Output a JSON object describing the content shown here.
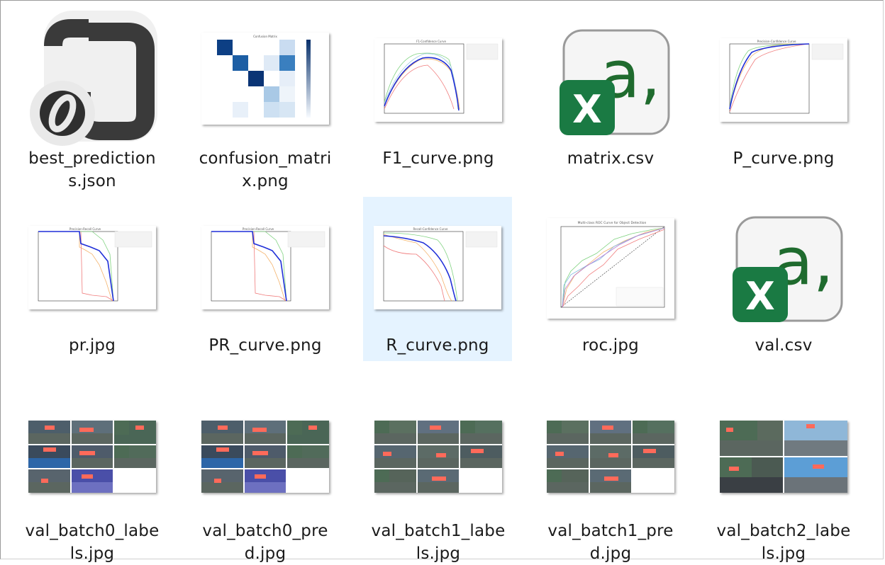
{
  "files": [
    {
      "name_lines": [
        "best_prediction",
        "s.json"
      ],
      "type": "json",
      "icon": "json-file-icon"
    },
    {
      "name_lines": [
        "confusion_matri",
        "x.png"
      ],
      "type": "confusion-matrix"
    },
    {
      "name_lines": [
        "F1_curve.png"
      ],
      "type": "curve"
    },
    {
      "name_lines": [
        "matrix.csv"
      ],
      "type": "csv",
      "icon": "excel-csv-icon"
    },
    {
      "name_lines": [
        "P_curve.png"
      ],
      "type": "curve"
    },
    {
      "name_lines": [
        "pr.jpg"
      ],
      "type": "curve"
    },
    {
      "name_lines": [
        "PR_curve.png"
      ],
      "type": "curve"
    },
    {
      "name_lines": [
        "R_curve.png"
      ],
      "type": "curve",
      "selected": true
    },
    {
      "name_lines": [
        "roc.jpg"
      ],
      "type": "roc"
    },
    {
      "name_lines": [
        "val.csv"
      ],
      "type": "csv",
      "icon": "excel-csv-icon"
    },
    {
      "name_lines": [
        "val_batch0_labe",
        "ls.jpg"
      ],
      "type": "mosaic"
    },
    {
      "name_lines": [
        "val_batch0_pre",
        "d.jpg"
      ],
      "type": "mosaic"
    },
    {
      "name_lines": [
        "val_batch1_labe",
        "ls.jpg"
      ],
      "type": "mosaic"
    },
    {
      "name_lines": [
        "val_batch1_pre",
        "d.jpg"
      ],
      "type": "mosaic"
    },
    {
      "name_lines": [
        "val_batch2_labe",
        "ls.jpg"
      ],
      "type": "mosaic"
    }
  ],
  "colors": {
    "selection": "#e5f3ff",
    "excel_green": "#1a7a43",
    "csv_letter": "#1f6b2e",
    "json_dark": "#3b3b3b",
    "curve_blue": "#1f2fd8"
  }
}
